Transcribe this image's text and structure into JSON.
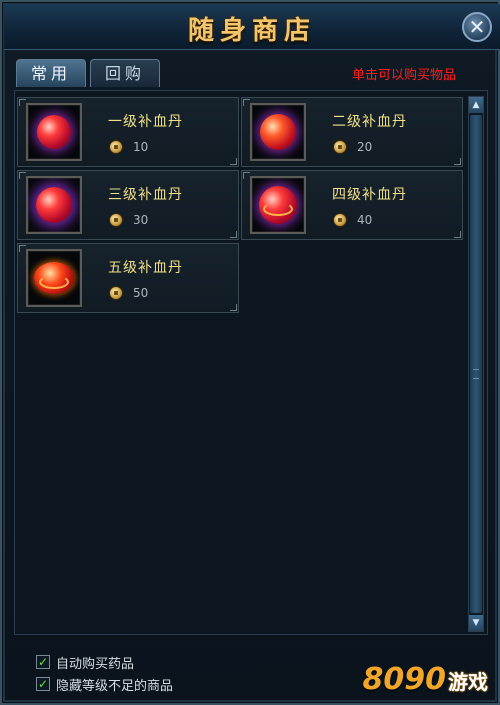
{
  "window": {
    "title": "随身商店",
    "close_icon": "close-icon"
  },
  "tabs": [
    {
      "label": "常用",
      "active": true
    },
    {
      "label": "回购",
      "active": false
    }
  ],
  "hint": "单击可以购买物品",
  "items": [
    {
      "name": "一级补血丹",
      "price": "10",
      "icon": "red-pill-icon"
    },
    {
      "name": "二级补血丹",
      "price": "20",
      "icon": "red-pill-icon"
    },
    {
      "name": "三级补血丹",
      "price": "30",
      "icon": "red-pill-icon"
    },
    {
      "name": "四级补血丹",
      "price": "40",
      "icon": "red-pill-icon"
    },
    {
      "name": "五级补血丹",
      "price": "50",
      "icon": "red-pill-icon"
    }
  ],
  "options": [
    {
      "label": "自动购买药品",
      "checked": true
    },
    {
      "label": "隐藏等级不足的商品",
      "checked": true
    }
  ],
  "watermark": {
    "number": "8090",
    "text": "游戏"
  },
  "colors": {
    "title": "#f2c66a",
    "hint": "#ff1e1e",
    "item_name": "#f0e088",
    "checkmark": "#5fe24a"
  }
}
